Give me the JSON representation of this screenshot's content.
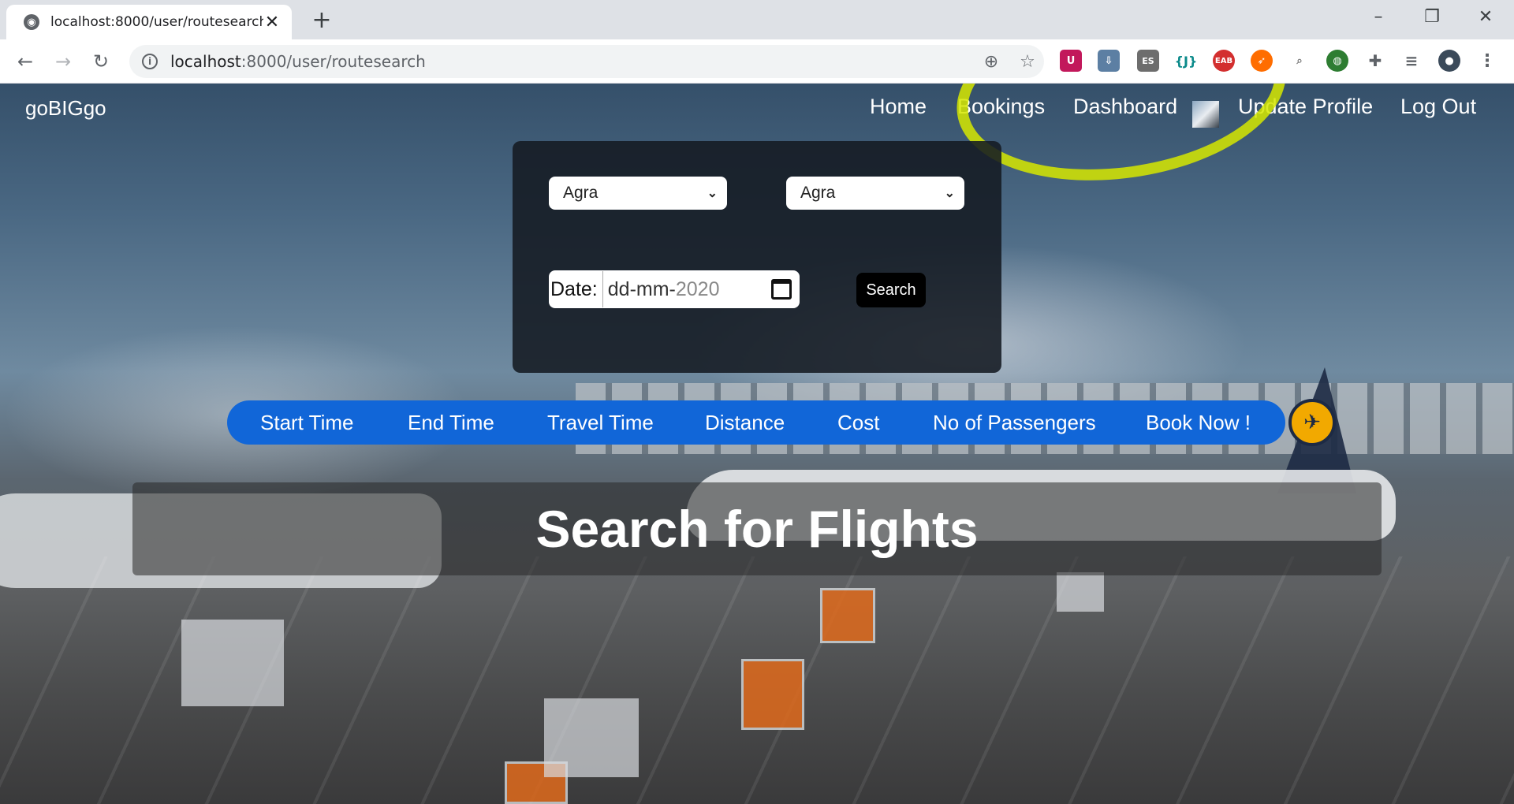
{
  "browser": {
    "tab_title": "localhost:8000/user/routesearch",
    "tab_close": "✕",
    "new_tab": "+",
    "url_host": "localhost",
    "url_path": ":8000/user/routesearch",
    "extensions": [
      "ES",
      "{J}",
      "EAB"
    ]
  },
  "nav": {
    "brand": "goBIGgo",
    "home": "Home",
    "bookings": "Bookings",
    "dashboard": "Dashboard",
    "update_profile": "Update Profile",
    "logout": "Log Out"
  },
  "search": {
    "from_value": "Agra",
    "to_value": "Agra",
    "date_label": "Date:",
    "date_dm": "dd-mm-",
    "date_year": "2020",
    "search_button": "Search"
  },
  "columns": [
    "Start Time",
    "End Time",
    "Travel Time",
    "Distance",
    "Cost",
    "No of Passengers",
    "Book Now !"
  ],
  "heading": "Search for Flights",
  "colors": {
    "accent_blue": "#1166d8",
    "highlight": "#d6e800"
  }
}
